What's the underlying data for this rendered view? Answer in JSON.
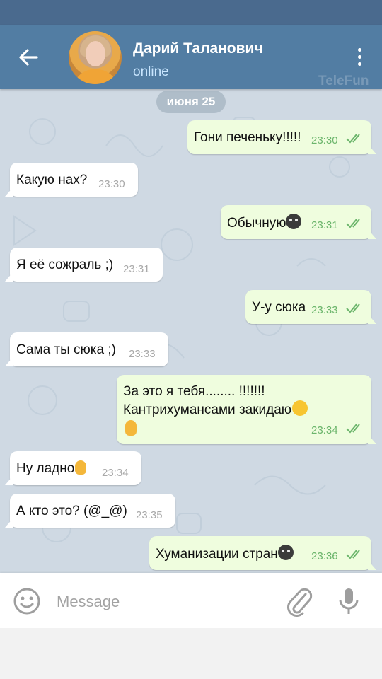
{
  "header": {
    "title": "Дарий Таланович",
    "status": "online",
    "watermark": "TeleFun"
  },
  "chat": {
    "date_label": "июня 25",
    "messages": [
      {
        "dir": "out",
        "text": "Гони печеньку!!!!!",
        "time": "23:30"
      },
      {
        "dir": "in",
        "text": "Какую нах?",
        "time": "23:30"
      },
      {
        "dir": "out",
        "text": "Обычную",
        "time": "23:31",
        "emoji": "black-smiley"
      },
      {
        "dir": "in",
        "text": "Я её сожраль ;)",
        "time": "23:31"
      },
      {
        "dir": "out",
        "text": "У-у сюка",
        "time": "23:33"
      },
      {
        "dir": "in",
        "text": "Сама ты сюка ;)",
        "time": "23:33"
      },
      {
        "dir": "out",
        "line1": "За это я тебя........ !!!!!!!",
        "line2": "Кантрихумансами закидаю",
        "time": "23:34",
        "emoji": [
          "tears-of-joy",
          "ok-hand"
        ]
      },
      {
        "dir": "in",
        "text": "Ну ладно",
        "time": "23:34",
        "emoji": "ok-hand"
      },
      {
        "dir": "in",
        "text": "А кто это? (@_@)",
        "time": "23:35"
      },
      {
        "dir": "out",
        "text": "Хуманизации стран",
        "time": "23:36",
        "emoji": "black-smiley"
      }
    ]
  },
  "composer": {
    "placeholder": "Message"
  },
  "colors": {
    "header": "#527da3",
    "status_bar": "#4a6a8e",
    "outgoing_bubble": "#effdde",
    "incoming_bubble": "#ffffff",
    "read_ticks": "#6bb56b"
  }
}
